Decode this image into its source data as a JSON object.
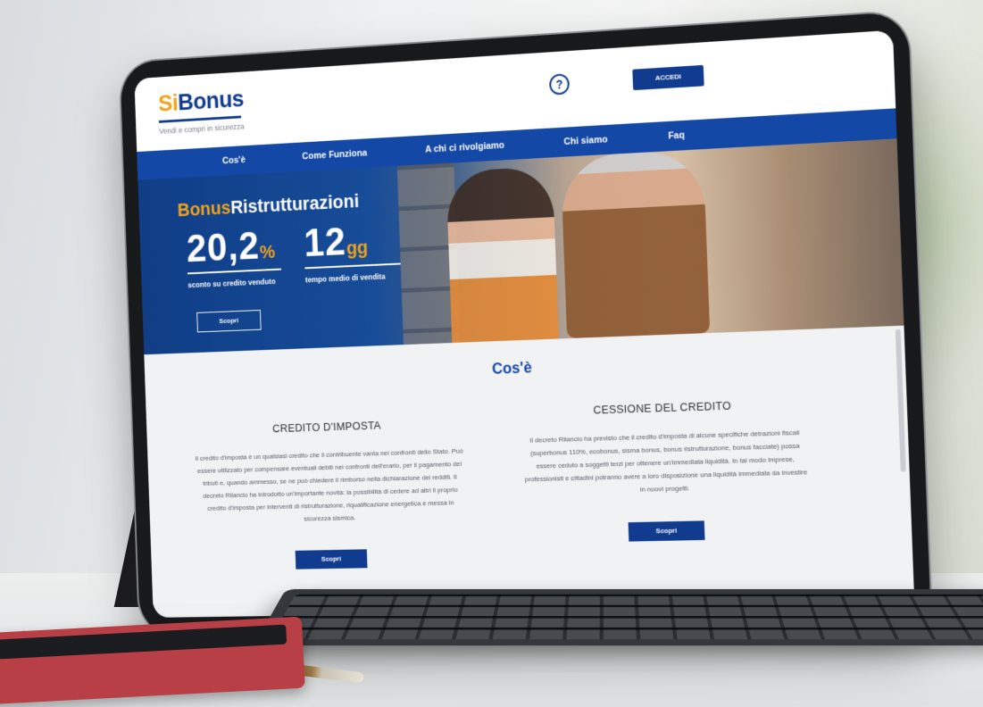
{
  "logo": {
    "part1": "Si",
    "part2": "Bonus",
    "tagline": "Vendi e compri in sicurezza"
  },
  "header": {
    "help_symbol": "?",
    "login_label": "ACCEDI"
  },
  "nav": {
    "items": [
      "Cos'è",
      "Come Funziona",
      "A chi ci rivolgiamo",
      "Chi siamo",
      "Faq"
    ]
  },
  "hero": {
    "title_part1": "Bonus",
    "title_part2": "Ristrutturazioni",
    "stat1": {
      "value": "20,2",
      "unit": "%",
      "label": "sconto su credito venduto"
    },
    "stat2": {
      "value": "12",
      "unit": "gg",
      "label": "tempo medio di vendita"
    },
    "button_label": "Scopri"
  },
  "section": {
    "title": "Cos'è",
    "col1": {
      "title": "CREDITO D'IMPOSTA",
      "text": "Il credito d'imposta è un qualsiasi credito che il contribuente vanta nei confronti dello Stato. Può essere utilizzato per compensare eventuali debiti nei confronti dell'erario, per il pagamento dei tributi e, quando ammesso, se ne può chiedere il rimborso nella dichiarazione dei redditi. Il decreto Rilancio ha introdotto un'importante novità: la possibilità di cedere ad altri il proprio credito d'imposta per interventi di ristrutturazione, riqualificazione energetica e messa in sicurezza sismica.",
      "button_label": "Scopri"
    },
    "col2": {
      "title": "CESSIONE DEL CREDITO",
      "text": "Il decreto Rilancio ha previsto che il credito d'imposta di alcune specifiche detrazioni fiscali (superbonus 110%, ecobonus, sisma bonus, bonus ristrutturazione, bonus facciate) possa essere ceduto a soggetti terzi per ottenere un'immediata liquidità. In tal modo imprese, professionisti e cittadini potranno avere a loro disposizione una liquidità immediata da investire in nuovi progetti.",
      "button_label": "Scopri"
    }
  },
  "colors": {
    "brand_blue": "#113b8f",
    "nav_blue": "#1448a6",
    "accent_orange": "#f2a31b"
  }
}
